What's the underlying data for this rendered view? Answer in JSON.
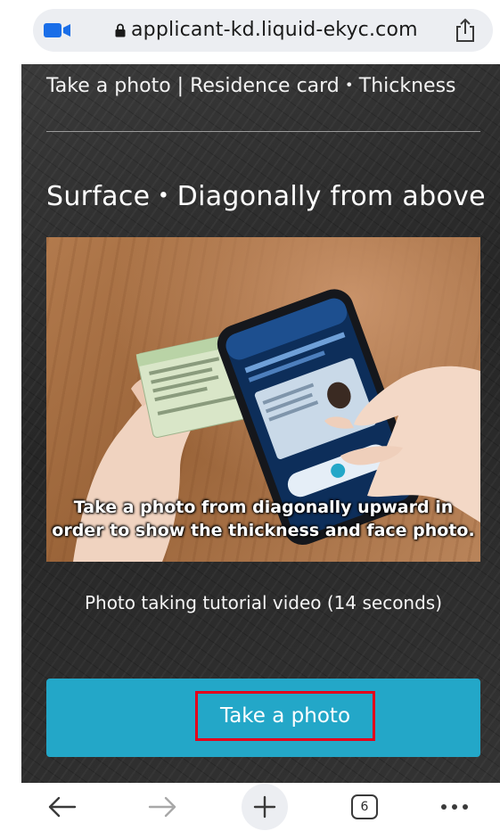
{
  "browser": {
    "url": "applicant-kd.liquid-ekyc.com",
    "tab_count": "6",
    "accent_color": "#1a6ee8"
  },
  "page": {
    "header": "Take a photo | Residence card・Thickness",
    "section_title": "Surface・Diagonally from above",
    "video": {
      "caption_line1": "Take a photo from diagonally upward in",
      "caption_line2": "order to show the thickness and face photo."
    },
    "video_description": "Photo taking tutorial video (14 seconds)",
    "cta_label": "Take a photo",
    "cta_color": "#23a7c8",
    "highlight_color": "#e3001b"
  }
}
